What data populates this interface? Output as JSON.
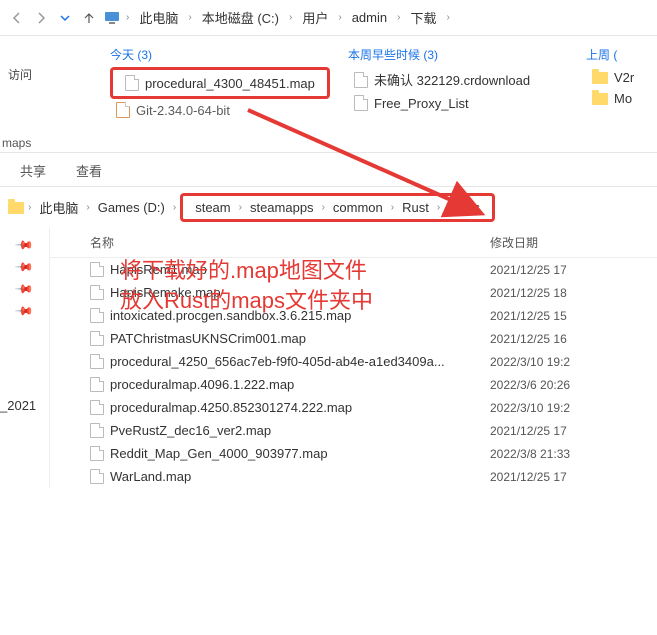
{
  "top_breadcrumb": [
    "此电脑",
    "本地磁盘 (C:)",
    "用户",
    "admin",
    "下载"
  ],
  "groups": {
    "today": {
      "header": "今天 (3)",
      "items": [
        "procedural_4300_48451.map",
        "Git-2.34.0-64-bit"
      ]
    },
    "earlier_week": {
      "header": "本周早些时候 (3)",
      "items": [
        "未确认 322129.crdownload",
        "Free_Proxy_List"
      ]
    },
    "last_week": {
      "header": "上周 (",
      "items": [
        "V2r",
        "Mo"
      ]
    }
  },
  "sidebar_top_label": "访问",
  "toolbar_label": "maps",
  "tabs": [
    "共享",
    "查看"
  ],
  "bc2_prefix": [
    "此电脑",
    "Games (D:)"
  ],
  "bc2_highlight": [
    "steam",
    "steamapps",
    "common",
    "Rust",
    "maps"
  ],
  "columns": {
    "name": "名称",
    "date": "修改日期"
  },
  "side_label": "_2021",
  "files": [
    {
      "name": "HapisRem1.map",
      "date": "2021/12/25 17"
    },
    {
      "name": "HapisRemake.map",
      "date": "2021/12/25 18"
    },
    {
      "name": "intoxicated.procgen.sandbox.3.6.215.map",
      "date": "2021/12/25 15"
    },
    {
      "name": "PATChristmasUKNSCrim001.map",
      "date": "2021/12/25 16"
    },
    {
      "name": "procedural_4250_656ac7eb-f9f0-405d-ab4e-a1ed3409a...",
      "date": "2022/3/10 19:2"
    },
    {
      "name": "proceduralmap.4096.1.222.map",
      "date": "2022/3/6 20:26"
    },
    {
      "name": "proceduralmap.4250.852301274.222.map",
      "date": "2022/3/10 19:2"
    },
    {
      "name": "PveRustZ_dec16_ver2.map",
      "date": "2021/12/25 17"
    },
    {
      "name": "Reddit_Map_Gen_4000_903977.map",
      "date": "2022/3/8 21:33"
    },
    {
      "name": "WarLand.map",
      "date": "2021/12/25 17"
    }
  ],
  "annotation": {
    "line1": "将下载好的.map地图文件",
    "line2": "放入Rust的maps文件夹中"
  }
}
